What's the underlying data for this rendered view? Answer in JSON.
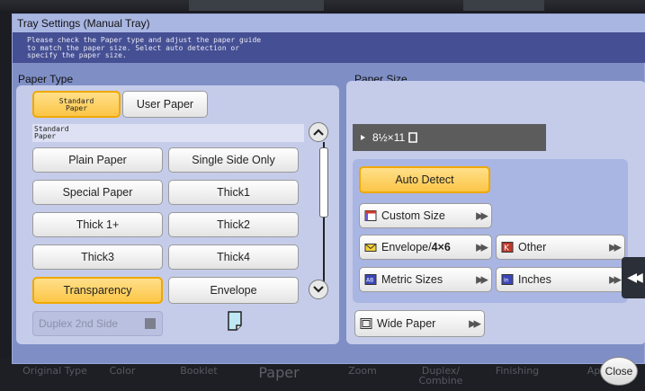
{
  "background": {
    "bottom_tabs": [
      "Original Type",
      "Color",
      "Booklet",
      "Paper",
      "Zoom",
      "Duplex/\nCombine",
      "Finishing",
      "Ap"
    ]
  },
  "dialog": {
    "title": "Tray Settings (Manual Tray)",
    "instructions": [
      "Please check the Paper type and adjust the paper guide",
      "to match the paper size. Select auto detection or",
      "specify the paper size."
    ]
  },
  "paper_type": {
    "label": "Paper Type",
    "tabs": [
      {
        "label": "Standard\nPaper",
        "selected": true
      },
      {
        "label": "User Paper",
        "selected": false
      }
    ],
    "group_label": "Standard\nPaper",
    "options": [
      {
        "label": "Plain Paper",
        "selected": false
      },
      {
        "label": "Single Side Only",
        "selected": false
      },
      {
        "label": "Special Paper",
        "selected": false
      },
      {
        "label": "Thick1",
        "selected": false
      },
      {
        "label": "Thick 1+",
        "selected": false
      },
      {
        "label": "Thick2",
        "selected": false
      },
      {
        "label": "Thick3",
        "selected": false
      },
      {
        "label": "Thick4",
        "selected": false
      },
      {
        "label": "Transparency",
        "selected": true
      },
      {
        "label": "Envelope",
        "selected": false
      }
    ],
    "duplex_label": "Duplex 2nd Side"
  },
  "paper_size": {
    "label": "Paper Size",
    "current_size": "8½×11",
    "auto_detect": "Auto Detect",
    "custom_size": "Custom Size",
    "envelope": "Envelope/",
    "envelope_bold": "4×6",
    "other": "Other",
    "metric": "Metric Sizes",
    "inches": "Inches",
    "wide_paper": "Wide Paper"
  },
  "footer": {
    "close": "Close"
  },
  "colors": {
    "accent": "#fcc647",
    "dialog_bg": "#7f8fc6",
    "panel_bg": "#c5ccea",
    "header_bg": "#454f93"
  }
}
